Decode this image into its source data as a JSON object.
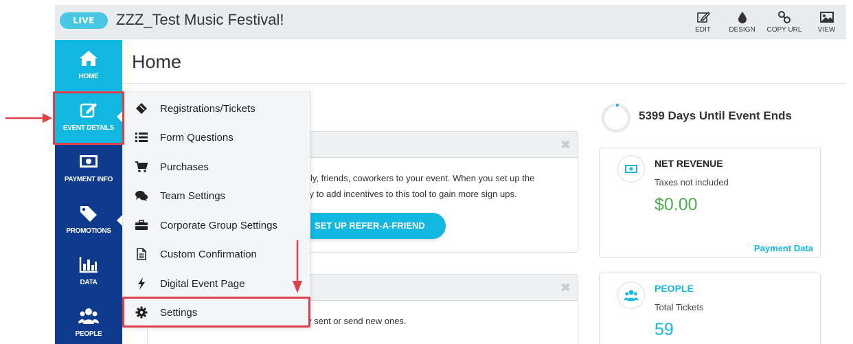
{
  "header": {
    "status_badge": "LIVE",
    "event_title": "ZZZ_Test Music Festival!",
    "actions": [
      {
        "label": "EDIT",
        "icon": "edit-icon"
      },
      {
        "label": "DESIGN",
        "icon": "droplet-icon"
      },
      {
        "label": "COPY URL",
        "icon": "link-icon"
      },
      {
        "label": "VIEW",
        "icon": "image-icon"
      }
    ]
  },
  "sidebar": {
    "items": [
      {
        "label": "HOME",
        "icon": "home-icon"
      },
      {
        "label": "EVENT DETAILS",
        "icon": "edit-square-icon",
        "active": true
      },
      {
        "label": "PAYMENT INFO",
        "icon": "money-icon"
      },
      {
        "label": "PROMOTIONS",
        "icon": "tag-icon"
      },
      {
        "label": "DATA",
        "icon": "bar-chart-icon"
      },
      {
        "label": "PEOPLE",
        "icon": "people-icon"
      }
    ]
  },
  "flyout": {
    "items": [
      {
        "label": "Registrations/Tickets",
        "icon": "ticket-icon"
      },
      {
        "label": "Form Questions",
        "icon": "list-icon"
      },
      {
        "label": "Purchases",
        "icon": "cart-icon"
      },
      {
        "label": "Team Settings",
        "icon": "chat-icon"
      },
      {
        "label": "Corporate Group Settings",
        "icon": "briefcase-icon"
      },
      {
        "label": "Custom Confirmation",
        "icon": "document-icon"
      },
      {
        "label": "Digital Event Page",
        "icon": "bolt-icon"
      },
      {
        "label": "Settings",
        "icon": "gear-icon"
      }
    ]
  },
  "main": {
    "page_title": "Home",
    "refer_panel": {
      "text_line1": "amily, friends, coworkers to your event. When you set up the",
      "text_line2": "bility to add incentives to this tool to gain more sign ups.",
      "button_label": "SET UP REFER-A-FRIEND",
      "close": "✖"
    },
    "second_panel": {
      "text": "y sent or send new ones.",
      "close": "✖"
    },
    "countdown": {
      "text": "5399 Days Until Event Ends",
      "progress_fraction": 0.03
    },
    "revenue_card": {
      "title": "NET REVENUE",
      "subtitle": "Taxes not included",
      "value": "$0.00",
      "link": "Payment Data",
      "value_color": "#4cae4c"
    },
    "people_card": {
      "title": "PEOPLE",
      "subtitle": "Total Tickets",
      "value": "59",
      "accent_color": "#12b8df"
    }
  },
  "colors": {
    "sidebar_bg": "#0e3a8d",
    "accent": "#12b8df",
    "highlight": "#e0404a"
  }
}
